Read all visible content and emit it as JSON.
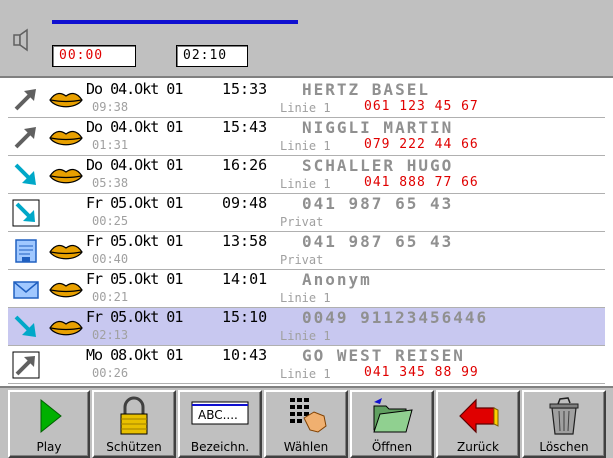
{
  "player": {
    "elapsed": "00:00",
    "total": "02:10",
    "progress_fraction": 1.0
  },
  "rows": [
    {
      "direction": "outgoing",
      "has_message": true,
      "date": "Do 04.Okt 01",
      "time": "15:33",
      "name": "HERTZ BASEL",
      "duration": "09:38",
      "line": "Linie 1",
      "number": "061 123 45 67",
      "selected": false
    },
    {
      "direction": "outgoing",
      "has_message": true,
      "date": "Do 04.Okt 01",
      "time": "15:43",
      "name": "NIGGLI MARTIN",
      "duration": "01:31",
      "line": "Linie 1",
      "number": "079 222 44 66",
      "selected": false
    },
    {
      "direction": "incoming",
      "has_message": true,
      "date": "Do 04.Okt 01",
      "time": "16:26",
      "name": "SCHALLER HUGO",
      "duration": "05:38",
      "line": "Linie 1",
      "number": "041 888 77 66",
      "selected": false
    },
    {
      "direction": "incoming-boxed",
      "has_message": false,
      "date": "Fr 05.Okt 01",
      "time": "09:48",
      "name": "041 987 65 43",
      "duration": "00:25",
      "line": "Privat",
      "number": "",
      "selected": false
    },
    {
      "direction": "fax",
      "has_message": true,
      "date": "Fr 05.Okt 01",
      "time": "13:58",
      "name": "041 987 65 43",
      "duration": "00:40",
      "line": "Privat",
      "number": "",
      "selected": false
    },
    {
      "direction": "mail",
      "has_message": true,
      "date": "Fr 05.Okt 01",
      "time": "14:01",
      "name": "Anonym",
      "duration": "00:21",
      "line": "Linie 1",
      "number": "",
      "selected": false
    },
    {
      "direction": "incoming",
      "has_message": true,
      "date": "Fr 05.Okt 01",
      "time": "15:10",
      "name": "0049 91123456446",
      "duration": "02:13",
      "line": "Linie 1",
      "number": "",
      "selected": true
    },
    {
      "direction": "outgoing-boxed",
      "has_message": false,
      "date": "Mo 08.Okt 01",
      "time": "10:43",
      "name": "GO WEST REISEN",
      "duration": "00:26",
      "line": "Linie 1",
      "number": "041 345 88 99",
      "selected": false
    }
  ],
  "toolbar": {
    "play": "Play",
    "protect": "Schützen",
    "label": "Bezeichn.",
    "label_icon_text": "ABC....",
    "dial": "Wählen",
    "open": "Öffnen",
    "back": "Zurück",
    "delete": "Löschen"
  },
  "colors": {
    "accent_blue": "#1010d0",
    "number_red": "#e00000",
    "selected_row": "#c8c8f0",
    "panel_gray": "#c0c0c0",
    "incoming_arrow": "#00a8c8"
  }
}
